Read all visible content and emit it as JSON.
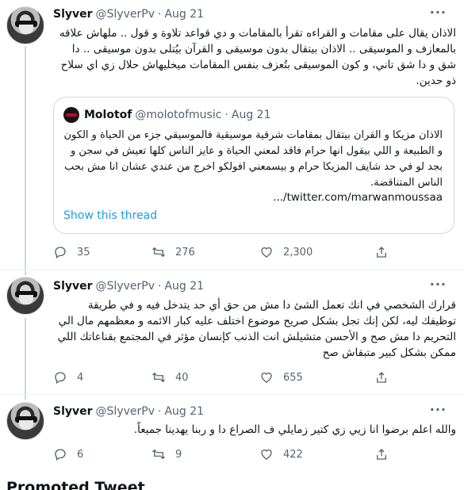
{
  "tweets": [
    {
      "name": "Slyver",
      "handle": "@SlyverPv",
      "dot": "·",
      "date": "Aug 21",
      "more": "···",
      "text": "الاذان يقال على مقامات و القراءه تقرأ بالمقامات و دي قواعد تلاوة و قول .. ملهاش علاقه بالمعازف و الموسيقى .. الاذان بيتقال بدون موسيقى و القرآن بيُتلى بدون موسيقى .. دا شق و دا شق تاني، و كون الموسيقى بتُعزف بنفس المقامات ميخليهاش حلال زي اي سلاح ذو حدين.",
      "quote": {
        "name": "Molotof",
        "handle": "@molotofmusic",
        "dot": "·",
        "date": "Aug 21",
        "text": "الاذان مزيكا و القران بيتقال بمقامات شرقية موسيقية فالموسيقي جزء من الحياة و الكون و الطبيعة و اللي بيقول انها حرام فاقد لمعني الحياة و عايز الناس كلها تعيش في سجن و بجد لو في حد شايف المزيكا حرام و بيسمعني افولكو اخرج من عندي عشان انا مش بحب الناس المتناقضة.",
        "link": ".../twitter.com/marwanmoussaa",
        "show_thread": "Show this thread"
      },
      "replies": "35",
      "retweets": "276",
      "likes": "2,300"
    },
    {
      "name": "Slyver",
      "handle": "@SlyverPv",
      "dot": "·",
      "date": "Aug 21",
      "more": "···",
      "text": "قرارك الشخصي في انك تعمل الشئ دا مش من حق أي حد يتدخل فيه و في طريقة توظيفك ليه، لكن إنك تجل بشكل صريح موضوع اختلف عليه كبار الائمه و معظمهم مال الي التحريم دا مش صح و الأحسن متشيلش انت الذنب كإنسان مؤثر في المجتمع بقناعاتك اللي ممكن بشكل كبير متبقاش صح",
      "replies": "4",
      "retweets": "40",
      "likes": "655"
    },
    {
      "name": "Slyver",
      "handle": "@SlyverPv",
      "dot": "·",
      "date": "Aug 21",
      "more": "···",
      "text": "والله اعلم برضوا انا زيي زي كتير زمايلي ف الصراع دا و ربنا يهدينا جميعاً.",
      "replies": "6",
      "retweets": "9",
      "likes": "422"
    }
  ],
  "promoted_label": "Promoted Tweet",
  "icons": {
    "reply": "reply-icon",
    "retweet": "retweet-icon",
    "like": "like-icon",
    "share": "share-icon"
  },
  "colors": {
    "link": "#1d9bf0",
    "muted": "#536471",
    "border": "#cfd9de"
  }
}
